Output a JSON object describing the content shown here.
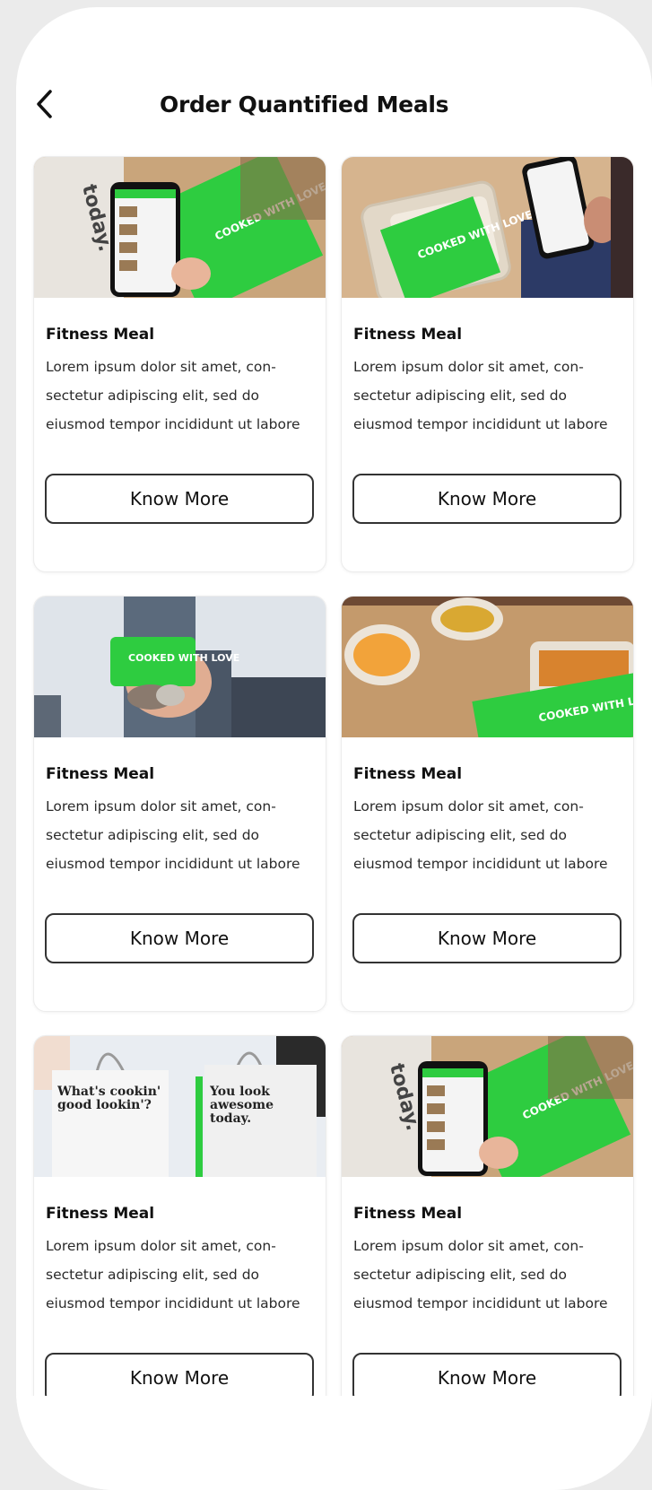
{
  "header": {
    "title": "Order Quantified Meals"
  },
  "colors": {
    "accent_green": "#2ecc40",
    "text": "#111111",
    "border": "#333333"
  },
  "icons": {
    "back": "chevron-left-icon"
  },
  "meals": [
    {
      "title": "Fitness Meal",
      "description": "Lorem ipsum dolor sit amet, con-sectetur adipiscing elit, sed do eiusmod tempor incididunt ut labore",
      "button_label": "Know More",
      "image_text": "today.",
      "image_box_text": "COOKED WITH LOVE"
    },
    {
      "title": "Fitness Meal",
      "description": "Lorem ipsum dolor sit amet, con-sectetur adipiscing elit, sed do eiusmod tempor incididunt ut labore",
      "button_label": "Know More",
      "image_box_text": "COOKED WITH LOVE"
    },
    {
      "title": "Fitness Meal",
      "description": "Lorem ipsum dolor sit amet, con-sectetur adipiscing elit, sed do eiusmod tempor incididunt ut labore",
      "button_label": "Know More",
      "image_box_text": "COOKED WITH LOVE"
    },
    {
      "title": "Fitness Meal",
      "description": "Lorem ipsum dolor sit amet, con-sectetur adipiscing elit, sed do eiusmod tempor incididunt ut labore",
      "button_label": "Know More",
      "image_box_text": "COOKED WITH LOVE."
    },
    {
      "title": "Fitness Meal",
      "description": "Lorem ipsum dolor sit amet, con-sectetur adipiscing elit, sed do eiusmod tempor incididunt ut labore",
      "button_label": "Know More",
      "image_bag_text_1": "What's cookin' good lookin'?",
      "image_bag_text_2": "You look awesome today."
    },
    {
      "title": "Fitness Meal",
      "description": "Lorem ipsum dolor sit amet, con-sectetur adipiscing elit, sed do eiusmod tempor incididunt ut labore",
      "button_label": "Know More",
      "image_text": "today.",
      "image_box_text": "COOKED WITH LOVE"
    }
  ]
}
